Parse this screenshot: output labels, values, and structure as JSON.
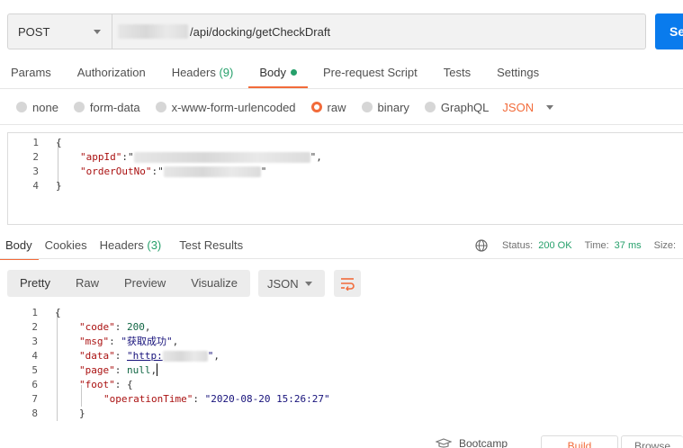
{
  "request": {
    "method": "POST",
    "url_visible": "/api/docking/getCheckDraft",
    "send_label": "Se"
  },
  "request_tabs": [
    {
      "label": "Params"
    },
    {
      "label": "Authorization"
    },
    {
      "label": "Headers",
      "count": "(9)"
    },
    {
      "label": "Body",
      "active": true
    },
    {
      "label": "Pre-request Script"
    },
    {
      "label": "Tests"
    },
    {
      "label": "Settings"
    }
  ],
  "body_types": {
    "none": "none",
    "form_data": "form-data",
    "urlencoded": "x-www-form-urlencoded",
    "raw": "raw",
    "binary": "binary",
    "graphql": "GraphQL",
    "format": "JSON"
  },
  "request_body": {
    "line_numbers": [
      "1",
      "2",
      "3",
      "4"
    ],
    "open_brace": "{",
    "key_appid": "\"appId\"",
    "key_orderoutno": "\"orderOutNo\"",
    "colon_quote": ":\"",
    "close_quote_comma": "\",",
    "close_quote": "\"",
    "close_brace": "}"
  },
  "response_tabs": [
    {
      "label": "Body",
      "active": true
    },
    {
      "label": "Cookies"
    },
    {
      "label": "Headers",
      "count": "(3)"
    },
    {
      "label": "Test Results"
    }
  ],
  "status": {
    "status_label": "Status:",
    "status_value": "200 OK",
    "time_label": "Time:",
    "time_value": "37 ms",
    "size_label": "Size:"
  },
  "response_view": {
    "pretty": "Pretty",
    "raw": "Raw",
    "preview": "Preview",
    "visualize": "Visualize",
    "format": "JSON"
  },
  "response_body": {
    "line_numbers": [
      "1",
      "2",
      "3",
      "4",
      "5",
      "6",
      "7",
      "8"
    ],
    "open_brace": "{",
    "code_key": "\"code\"",
    "code_value": "200",
    "msg_key": "\"msg\"",
    "msg_value": "\"获取成功\"",
    "data_key": "\"data\"",
    "data_value_visible": "\"http:",
    "page_key": "\"page\"",
    "page_value": "null",
    "foot_key": "\"foot\"",
    "operation_time_key": "\"operationTime\"",
    "operation_time_value": "\"2020-08-20 15:26:27\"",
    "close_brace": "}"
  },
  "footer": {
    "bootcamp": "Bootcamp",
    "build": "Build",
    "browse": "Browse"
  },
  "colors": {
    "accent": "#f26b3a",
    "success": "#26a06b",
    "send": "#097bed"
  }
}
